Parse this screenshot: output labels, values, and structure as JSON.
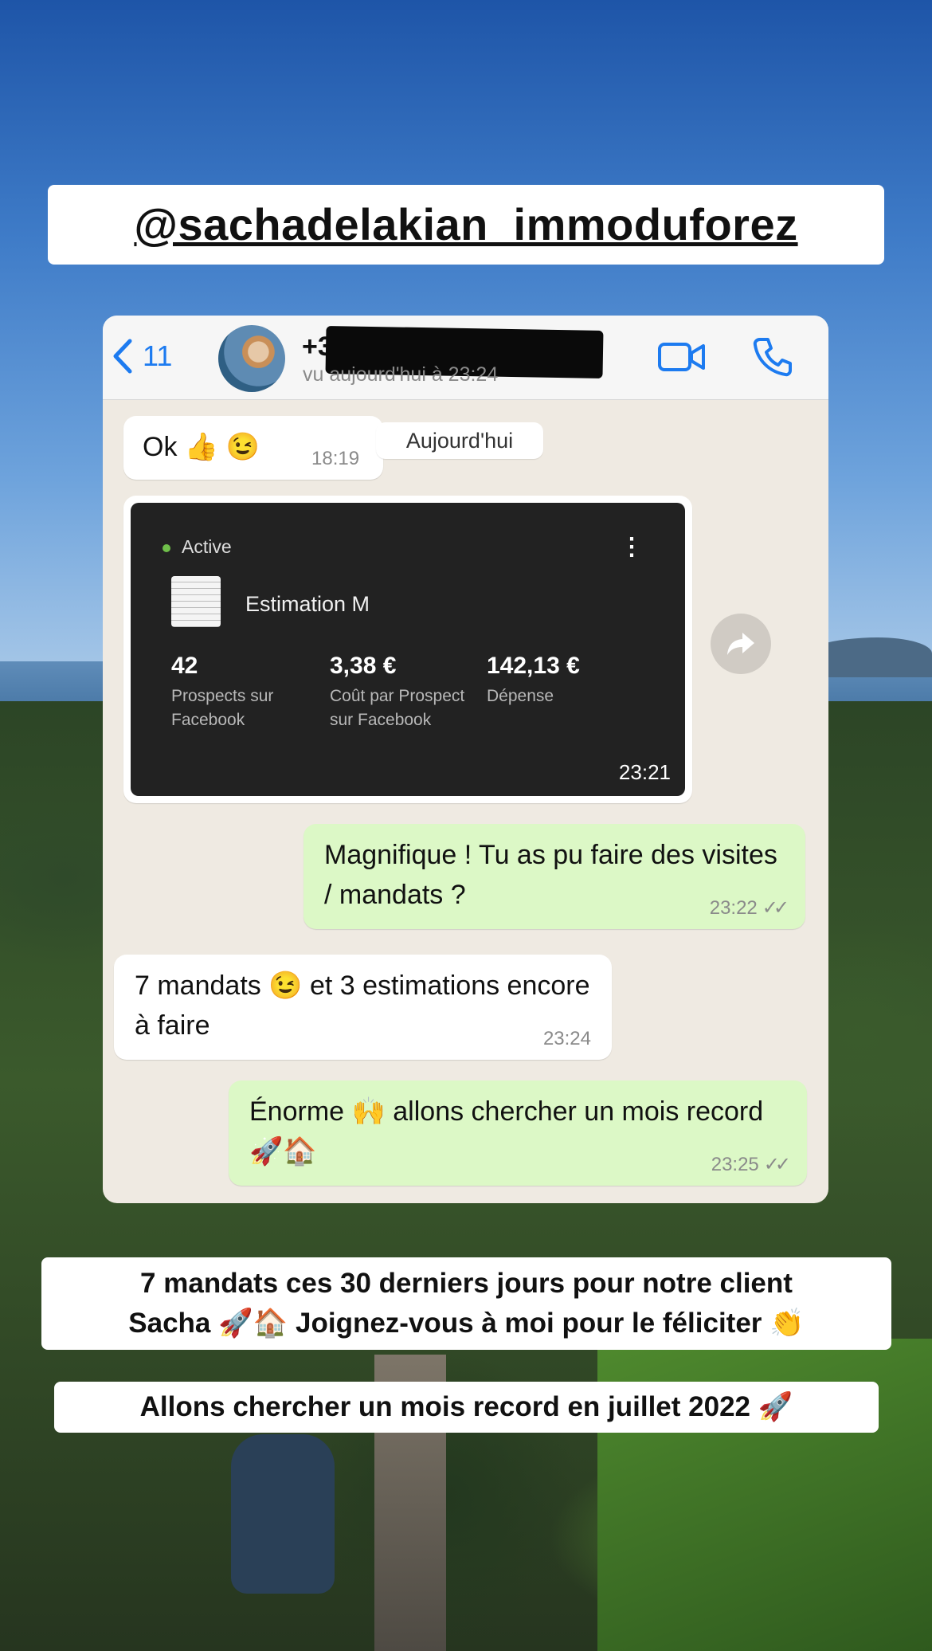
{
  "story": {
    "handle": "@sachadelakian_immoduforez",
    "caption_line1": "7 mandats ces 30 derniers jours pour notre client",
    "caption_line2": "Sacha 🚀🏠 Joignez-vous à moi pour le féliciter 👏",
    "caption_record": "Allons chercher un mois record en juillet 2022 🚀"
  },
  "chat": {
    "back_count": "11",
    "contact_number": "+3",
    "last_seen": "vu aujourd'hui à 23:24",
    "day_separator": "Aujourd'hui",
    "messages": [
      {
        "direction": "in",
        "text": "Ok 👍 😉",
        "time": "18:19"
      },
      {
        "direction": "in",
        "type": "image",
        "time": "23:21"
      },
      {
        "direction": "out",
        "text": "Magnifique ! Tu as pu faire des visites / mandats ?",
        "time": "23:22",
        "ticks": "✓✓"
      },
      {
        "direction": "in",
        "text": "7 mandats 😉 et 3 estimations encore à faire",
        "time": "23:24"
      },
      {
        "direction": "out",
        "text": "Énorme 🙌 allons chercher un mois record 🚀🏠",
        "time": "23:25",
        "ticks": "✓✓"
      }
    ],
    "ad": {
      "status": "Active",
      "title": "Estimation M",
      "stats": [
        {
          "value": "42",
          "label": "Prospects sur Facebook"
        },
        {
          "value": "3,38 €",
          "label": "Coût par Prospect sur Facebook"
        },
        {
          "value": "142,13 €",
          "label": "Dépense"
        }
      ]
    }
  },
  "icons": [
    "chevron-left-icon",
    "video-camera-icon",
    "phone-icon",
    "more-vertical-icon",
    "forward-icon"
  ],
  "colors": {
    "accent": "#1d7bf0",
    "incoming_bubble": "#ffffff",
    "outgoing_bubble": "#dcf8c6",
    "chat_bg": "#efeae2",
    "ad_card_bg": "#222222",
    "active_dot": "#6fbf4a"
  }
}
